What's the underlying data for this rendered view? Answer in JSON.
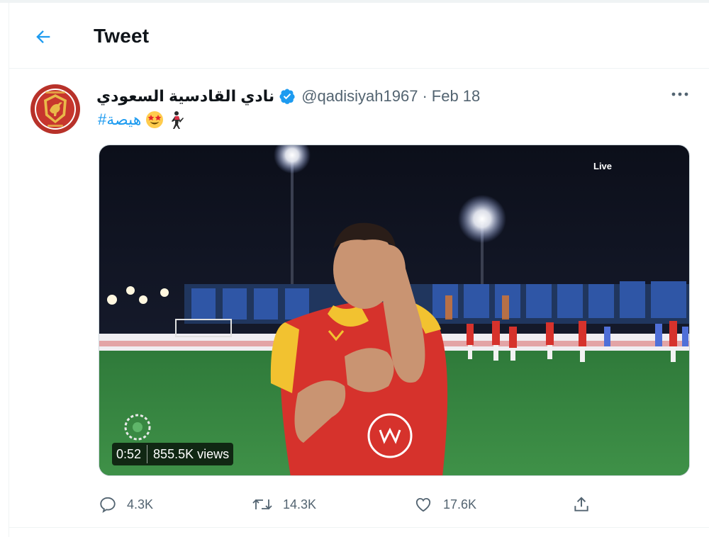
{
  "header": {
    "title": "Tweet",
    "back_icon": "arrow-left-icon"
  },
  "tweet": {
    "display_name": "نادي القادسية السعودي",
    "verified_icon": "verified-badge-icon",
    "handle": "@qadisiyah1967",
    "separator": "·",
    "date": "Feb 18",
    "more_icon": "more-horizontal-icon",
    "text": {
      "emojis": [
        "person-dancing-emoji",
        "star-struck-emoji"
      ],
      "hashtag": "#هيصة"
    },
    "media": {
      "type": "video",
      "duration": "0:52",
      "views": "855.5K views",
      "broadcast_badge": "Live"
    },
    "actions": {
      "reply": {
        "icon": "reply-icon",
        "count": "4.3K"
      },
      "retweet": {
        "icon": "retweet-icon",
        "count": "14.3K"
      },
      "like": {
        "icon": "heart-icon",
        "count": "17.6K"
      },
      "share": {
        "icon": "share-icon"
      }
    }
  },
  "colors": {
    "accent": "#1d9bf0",
    "secondary_text": "#536471",
    "primary_text": "#0f1419",
    "border": "#eff3f4"
  }
}
